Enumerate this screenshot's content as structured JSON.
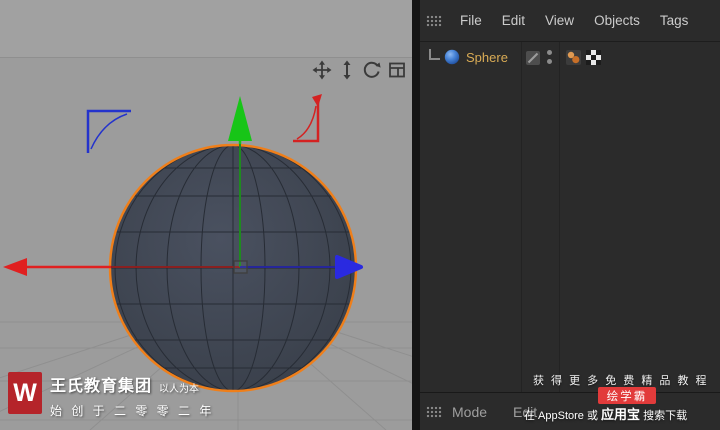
{
  "colors": {
    "viewport_bg": "#9c9c9c",
    "grid_line": "#8d8d8d",
    "panel_bg": "#2b2b2b",
    "menu_text": "#cccccc",
    "object_name_text": "#d9ab55",
    "mode_text": "#9f9f9f",
    "sphere_fill_light": "#4a5160",
    "sphere_fill_dark": "#373d47",
    "sphere_wire": "#272c35",
    "selection_orange": "#ef7f1a",
    "axis_green": "#17c517",
    "axis_green_dark": "#1f8a1f",
    "axis_red": "#e02020",
    "axis_red_dark": "#8a2020",
    "axis_blue": "#2a2ae0",
    "axis_blue_dark": "#26269a",
    "hud_red": "#d42222",
    "hud_blue": "#2433cc",
    "icon_dark": "#3a3a3a",
    "logo_red": "#b5242a",
    "badge_red": "#e23b3b"
  },
  "viewport": {
    "nav_icons": [
      {
        "name": "pan"
      },
      {
        "name": "dolly"
      },
      {
        "name": "rotate"
      },
      {
        "name": "maximize"
      }
    ]
  },
  "object_panel": {
    "menu": [
      "File",
      "Edit",
      "View",
      "Objects",
      "Tags"
    ],
    "objects": [
      {
        "name": "Sphere",
        "icon": "sphere-primitive",
        "tags": [
          "phong-tag",
          "uvw-tag"
        ]
      }
    ]
  },
  "mode_bar": {
    "items": [
      "Mode",
      "Edit"
    ]
  },
  "watermark": {
    "logo_text": "W",
    "title": "王氏教育集团",
    "subtitle": "以人为本",
    "line2": "始 创 于 二 零 零 二 年"
  },
  "promo": {
    "line1": "获 得 更 多 免 费 精 品 教 程",
    "badge": "绘学霸",
    "line2_prefix": "在 AppStore 或 ",
    "line2_highlight": "应用宝",
    "line2_suffix": " 搜索下载"
  }
}
